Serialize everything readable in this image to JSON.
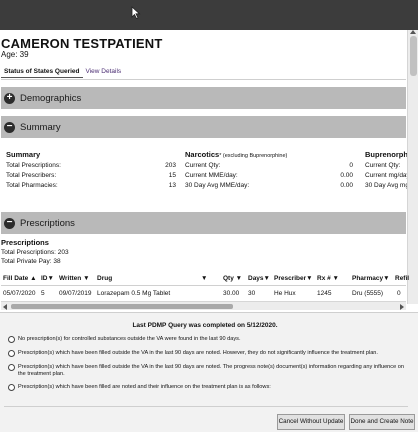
{
  "patient": {
    "name": "CAMERON TESTPATIENT",
    "age": "Age: 39"
  },
  "tabs": [
    {
      "label": "Status of States Queried"
    },
    {
      "label": "View Details"
    }
  ],
  "sections": {
    "demographics": {
      "label": "Demographics",
      "toggle": "+"
    },
    "summary": {
      "label": "Summary",
      "toggle": "−"
    },
    "prescriptions": {
      "label": "Prescriptions",
      "toggle": "−"
    }
  },
  "summary": {
    "general": {
      "heading": "Summary",
      "rows": [
        {
          "label": "Total Prescriptions:",
          "value": "203"
        },
        {
          "label": "Total Prescribers:",
          "value": "15"
        },
        {
          "label": "Total Pharmacies:",
          "value": "13"
        }
      ]
    },
    "narcotics": {
      "heading": "Narcotics",
      "heading_note": "* (excluding Buprenorphine)",
      "rows": [
        {
          "label": "Current Qty:",
          "value": "0"
        },
        {
          "label": "Current MME/day:",
          "value": "0.00"
        },
        {
          "label": "30 Day Avg MME/day:",
          "value": "0.00"
        }
      ]
    },
    "buprenorphine": {
      "heading": "Buprenorphi",
      "rows": [
        {
          "label": "Current Qty:"
        },
        {
          "label": "Current mg/day"
        },
        {
          "label": "30 Day Avg mg/"
        }
      ]
    }
  },
  "prescriptions": {
    "heading": "Prescriptions",
    "total_prescriptions": "Total Prescriptions: 203",
    "total_private_pay": "Total Private Pay:  38",
    "columns": [
      "Fill Date ▲",
      "ID▼",
      "Written ▼",
      "Drug",
      "▼",
      "Qty ▼",
      "Days▼",
      "Prescriber▼",
      "Rx # ▼",
      "Pharmacy▼",
      "Refil"
    ],
    "rows": [
      {
        "fill_date": "05/07/2020",
        "id": "5",
        "written": "09/07/2019",
        "drug": "Lorazepam 0.5 Mg Tablet",
        "qty": "30.00",
        "days": "30",
        "prescriber": "He Hux",
        "rx": "1245",
        "pharmacy": "Dru (5555)",
        "refills": "0"
      }
    ]
  },
  "query": {
    "message": "Last PDMP Query was completed on 5/12/2020.",
    "options": [
      "No prescription(s) for controlled substances outside the VA were found in the last 90 days.",
      "Prescription(s) which have been filled outside the VA in the last 90 days are noted. However, they do not significantly influence the treatment plan.",
      "Prescription(s) which have been filled outside the VA in the last 90 days are noted. The progress note(s) document(s) information regarding any influence on the treatment plan.",
      "Prescription(s) which have been filled are noted and their influence on the treatment plan is as follows:"
    ]
  },
  "buttons": {
    "cancel": "Cancel Without Update",
    "done": "Done and Create Note"
  },
  "icons": {
    "cursor": "mouse-pointer-icon",
    "expand": "plus-circle-icon",
    "collapse": "minus-circle-icon"
  }
}
